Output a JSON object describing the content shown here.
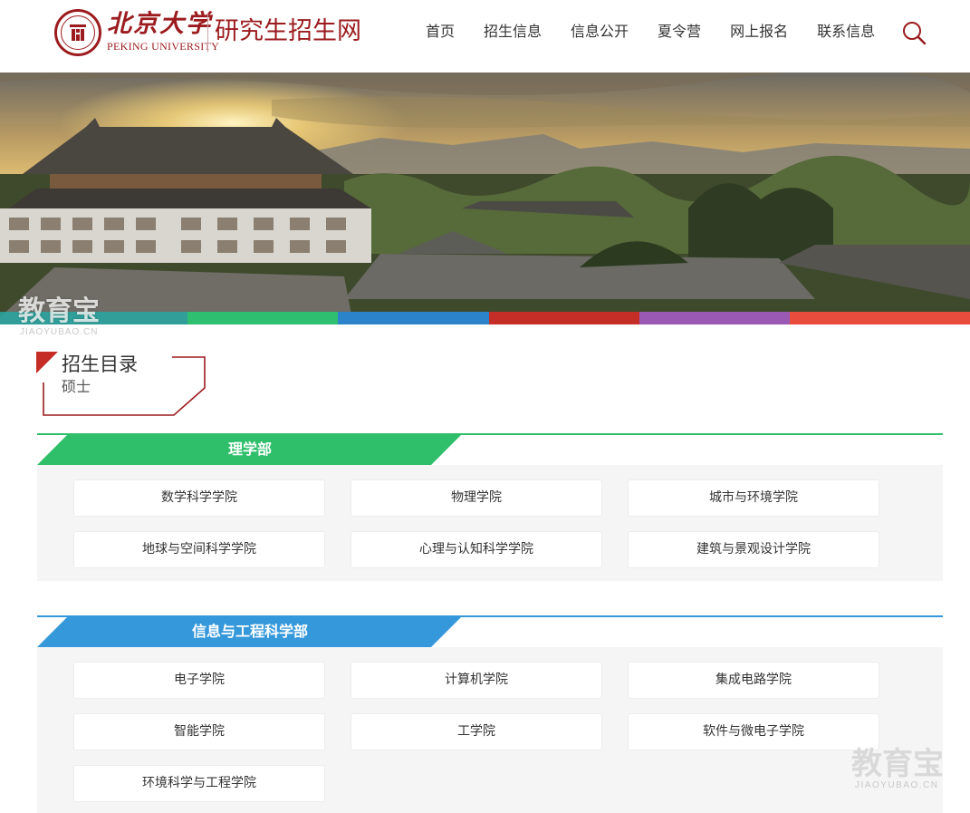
{
  "header": {
    "logo_cn": "北京大学",
    "logo_en": "PEKING UNIVERSITY",
    "site_title": "研究生招生网",
    "nav": [
      "首页",
      "招生信息",
      "信息公开",
      "夏令营",
      "网上报名",
      "联系信息"
    ],
    "search_icon": "search-icon",
    "brand_color": "#9b1b1e"
  },
  "banner": {
    "stripe_colors": [
      "#27a7a2",
      "#2fbf71",
      "#2b83c9",
      "#c42e26",
      "#9b59b6",
      "#e74c3c"
    ]
  },
  "watermark": {
    "text": "教育宝",
    "url": "JIAOYUBAO.CN"
  },
  "catalog": {
    "title": "招生目录",
    "subtitle": "硕士"
  },
  "departments": [
    {
      "name": "理学部",
      "color": "#2fbf6b",
      "colleges": [
        [
          "数学科学学院",
          "物理学院",
          "城市与环境学院"
        ],
        [
          "地球与空间科学学院",
          "心理与认知科学学院",
          "建筑与景观设计学院"
        ]
      ]
    },
    {
      "name": "信息与工程科学部",
      "color": "#3498db",
      "colleges": [
        [
          "电子学院",
          "计算机学院",
          "集成电路学院"
        ],
        [
          "智能学院",
          "工学院",
          "软件与微电子学院"
        ],
        [
          "环境科学与工程学院"
        ]
      ]
    }
  ]
}
